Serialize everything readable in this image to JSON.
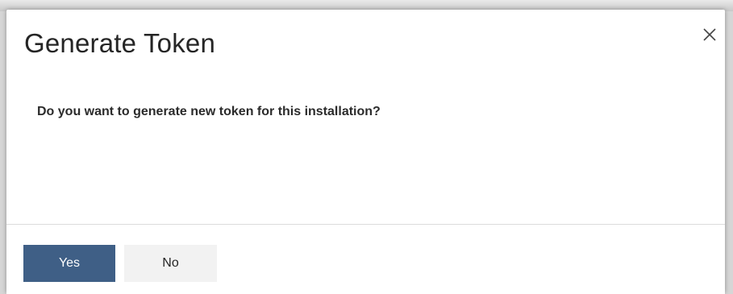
{
  "dialog": {
    "title": "Generate Token",
    "message": "Do you want to generate new token for this installation?",
    "close_icon": "close-icon",
    "buttons": {
      "yes_label": "Yes",
      "no_label": "No"
    },
    "colors": {
      "primary_button": "#3f5f86",
      "secondary_button": "#f2f2f2"
    }
  }
}
